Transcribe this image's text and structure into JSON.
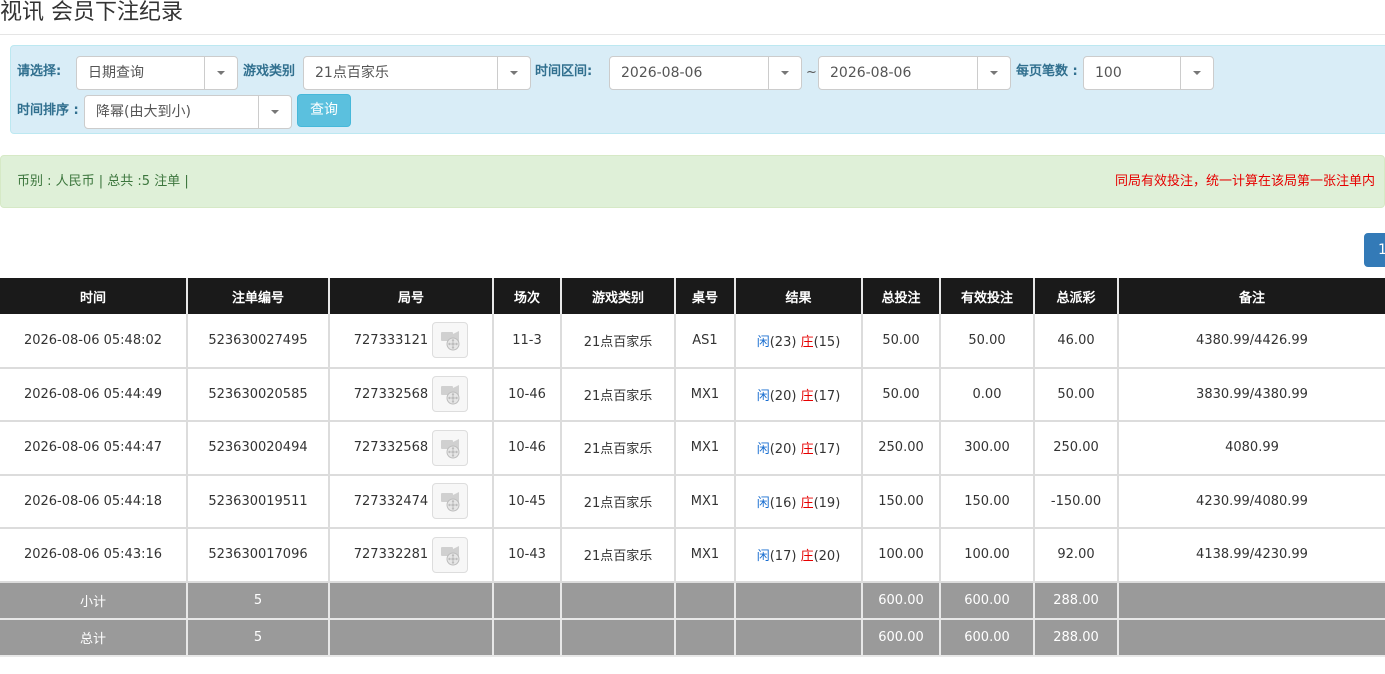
{
  "page": {
    "title": "视讯 会员下注纪录"
  },
  "filters": {
    "select_label": "请选择:",
    "select_value": "日期查询",
    "game_type_label": "游戏类别",
    "game_type_value": "21点百家乐",
    "range_label": "时间区间:",
    "date_start": "2026-08-06",
    "range_sep": "~",
    "date_end": "2026-08-06",
    "per_page_label": "每页笔数 :",
    "per_page_value": "100",
    "sort_label": "时间排序 :",
    "sort_value": "降幂(由大到小)",
    "query_button": "查询"
  },
  "info": {
    "summary": "币别 : 人民币 | 总共 :5 注单 |",
    "notice": "同局有效投注，统一计算在该局第一张注单内"
  },
  "pager": {
    "current": "1"
  },
  "table": {
    "headers": [
      "时间",
      "注单编号",
      "局号",
      "场次",
      "游戏类别",
      "桌号",
      "结果",
      "总投注",
      "有效投注",
      "总派彩",
      "备注"
    ],
    "rows": [
      {
        "time": "2026-08-06 05:48:02",
        "bet_id": "523630027495",
        "round": "727333121",
        "session": "11-3",
        "game": "21点百家乐",
        "table": "AS1",
        "res_p_label": "闲",
        "res_p_val": "(23)",
        "res_b_label": "庄",
        "res_b_val": "(15)",
        "total_bet": "50.00",
        "valid_bet": "50.00",
        "payout": "46.00",
        "note": "4380.99/4426.99"
      },
      {
        "time": "2026-08-06 05:44:49",
        "bet_id": "523630020585",
        "round": "727332568",
        "session": "10-46",
        "game": "21点百家乐",
        "table": "MX1",
        "res_p_label": "闲",
        "res_p_val": "(20)",
        "res_b_label": "庄",
        "res_b_val": "(17)",
        "total_bet": "50.00",
        "valid_bet": "0.00",
        "payout": "50.00",
        "note": "3830.99/4380.99"
      },
      {
        "time": "2026-08-06 05:44:47",
        "bet_id": "523630020494",
        "round": "727332568",
        "session": "10-46",
        "game": "21点百家乐",
        "table": "MX1",
        "res_p_label": "闲",
        "res_p_val": "(20)",
        "res_b_label": "庄",
        "res_b_val": "(17)",
        "total_bet": "250.00",
        "valid_bet": "300.00",
        "payout": "250.00",
        "note": "4080.99"
      },
      {
        "time": "2026-08-06 05:44:18",
        "bet_id": "523630019511",
        "round": "727332474",
        "session": "10-45",
        "game": "21点百家乐",
        "table": "MX1",
        "res_p_label": "闲",
        "res_p_val": "(16)",
        "res_b_label": "庄",
        "res_b_val": "(19)",
        "total_bet": "150.00",
        "valid_bet": "150.00",
        "payout": "-150.00",
        "note": "4230.99/4080.99"
      },
      {
        "time": "2026-08-06 05:43:16",
        "bet_id": "523630017096",
        "round": "727332281",
        "session": "10-43",
        "game": "21点百家乐",
        "table": "MX1",
        "res_p_label": "闲",
        "res_p_val": "(17)",
        "res_b_label": "庄",
        "res_b_val": "(20)",
        "total_bet": "100.00",
        "valid_bet": "100.00",
        "payout": "92.00",
        "note": "4138.99/4230.99"
      }
    ],
    "subtotal": {
      "label": "小计",
      "count": "5",
      "total_bet": "600.00",
      "valid_bet": "600.00",
      "payout": "288.00"
    },
    "total": {
      "label": "总计",
      "count": "5",
      "total_bet": "600.00",
      "valid_bet": "600.00",
      "payout": "288.00"
    }
  },
  "colors": {
    "header_bg": "#1a1a1a",
    "filter_bg": "#d9edf7",
    "info_bg": "#dff0d8",
    "player": "#1a6fd1",
    "banker": "#e60000",
    "summary_bg": "#9a9a9a"
  },
  "icons": {
    "replay": "video-replay-icon"
  }
}
